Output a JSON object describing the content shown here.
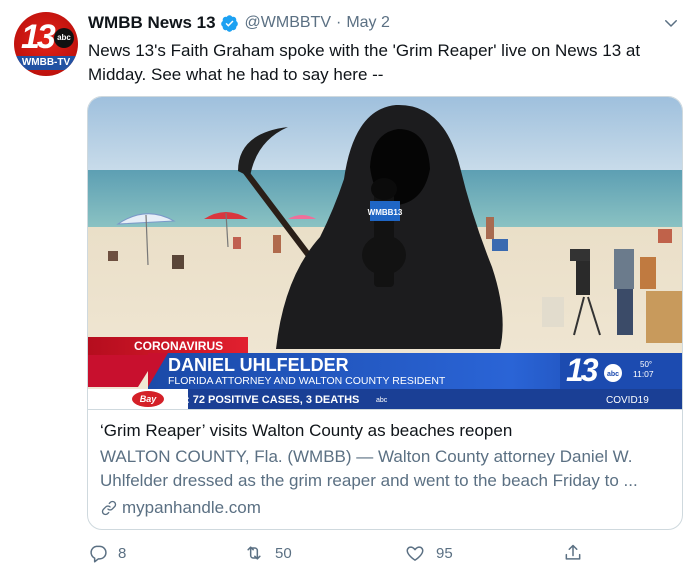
{
  "account": {
    "display_name": "WMBB News 13",
    "handle": "@WMBBTV",
    "separator": "·",
    "date": "May 2",
    "avatar_number": "13",
    "avatar_network": "abc",
    "avatar_callsign": "WMBB-TV"
  },
  "tweet": {
    "text_lines": [
      "News 13's Faith Graham spoke with the 'Grim Reaper' live on News 13 at",
      "Midday. See what he had to say here --"
    ]
  },
  "media": {
    "mic_flag": "WMBB13",
    "lower_third": {
      "topic": "CORONAVIRUS",
      "name": "DANIEL UHLFELDER",
      "subtitle": "FLORIDA ATTORNEY AND WALTON COUNTY RESIDENT",
      "ticker": ": 72 POSITIVE CASES, 3 DEATHS",
      "ticker_network": "abc",
      "sponsor": "Bay",
      "station_number": "13",
      "station_network": "abc",
      "temperature": "50°",
      "time": "11:07",
      "segment": "COVID19"
    }
  },
  "card": {
    "title": "‘Grim Reaper’ visits Walton County as beaches reopen",
    "description_lines": [
      "WALTON COUNTY, Fla. (WMBB) — Walton County attorney Daniel W.",
      "Uhlfelder dressed as the grim reaper and went to the beach Friday to ..."
    ],
    "domain": "mypanhandle.com"
  },
  "actions": {
    "replies": "8",
    "retweets": "50",
    "likes": "95"
  },
  "colors": {
    "name_text": "#0f1419",
    "secondary_text": "#5b7083",
    "verified_blue": "#1da1f2",
    "card_border": "#cfd9de",
    "lower_third_red": "#c8102e",
    "lower_third_blue": "#1b4aa8"
  },
  "icons": {
    "verified": "verified-badge-icon",
    "caret": "chevron-down-icon",
    "link": "link-icon",
    "reply": "reply-icon",
    "retweet": "retweet-icon",
    "like": "heart-icon",
    "share": "share-icon"
  }
}
